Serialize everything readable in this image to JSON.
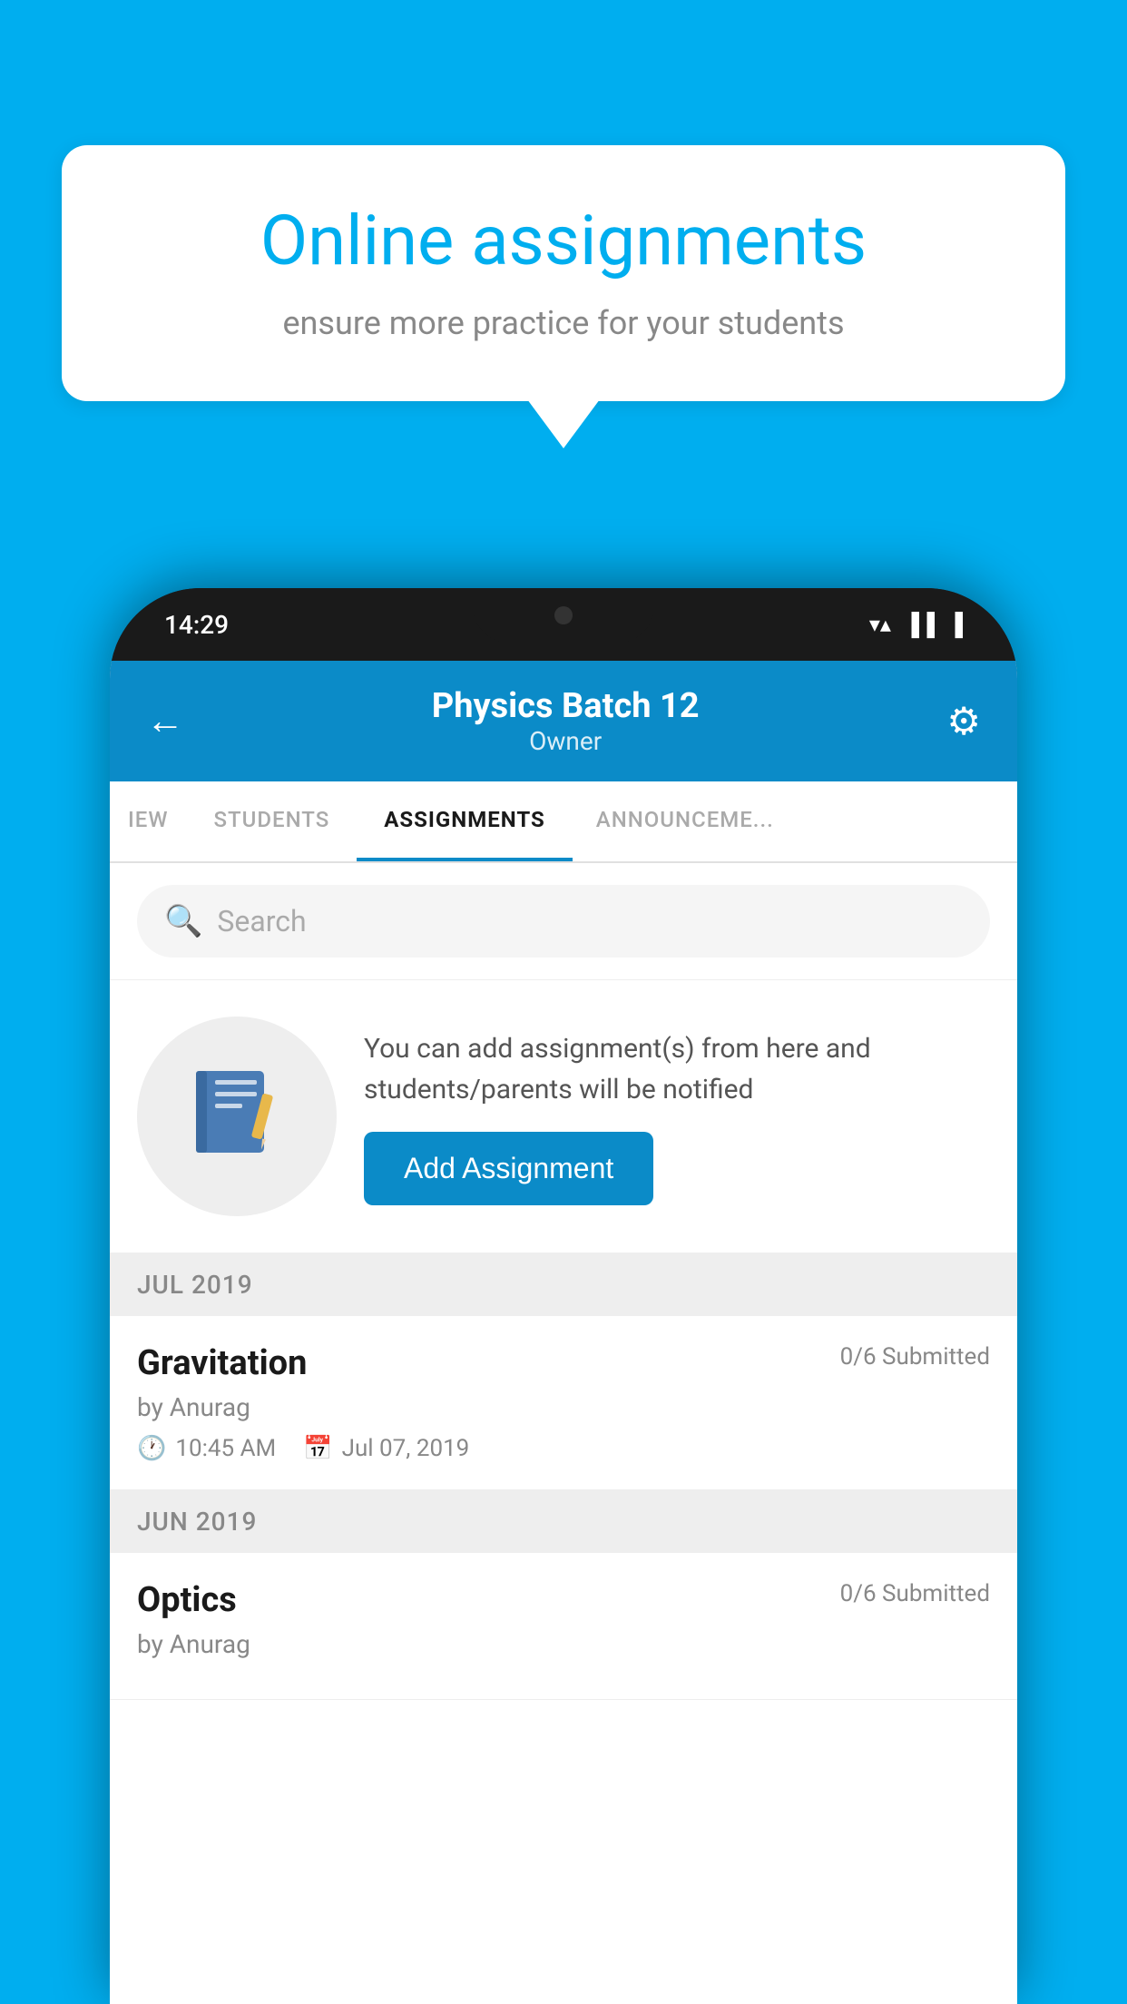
{
  "background": {
    "color": "#00AEEF"
  },
  "speech_bubble": {
    "title": "Online assignments",
    "subtitle": "ensure more practice for your students"
  },
  "phone": {
    "status_bar": {
      "time": "14:29",
      "wifi": "▼",
      "signal": "▲",
      "battery": "▐"
    },
    "app_bar": {
      "back_icon": "←",
      "title": "Physics Batch 12",
      "subtitle": "Owner",
      "settings_icon": "⚙"
    },
    "tabs": [
      {
        "label": "IEW",
        "active": false
      },
      {
        "label": "STUDENTS",
        "active": false
      },
      {
        "label": "ASSIGNMENTS",
        "active": true
      },
      {
        "label": "ANNOUNCEMENTS",
        "active": false
      }
    ],
    "search": {
      "placeholder": "Search",
      "icon": "🔍"
    },
    "promo": {
      "text": "You can add assignment(s) from here and students/parents will be notified",
      "button_label": "Add Assignment"
    },
    "assignment_sections": [
      {
        "header": "JUL 2019",
        "assignments": [
          {
            "name": "Gravitation",
            "submitted": "0/6 Submitted",
            "by": "by Anurag",
            "time": "10:45 AM",
            "date": "Jul 07, 2019"
          }
        ]
      },
      {
        "header": "JUN 2019",
        "assignments": [
          {
            "name": "Optics",
            "submitted": "0/6 Submitted",
            "by": "by Anurag",
            "time": "",
            "date": ""
          }
        ]
      }
    ]
  }
}
